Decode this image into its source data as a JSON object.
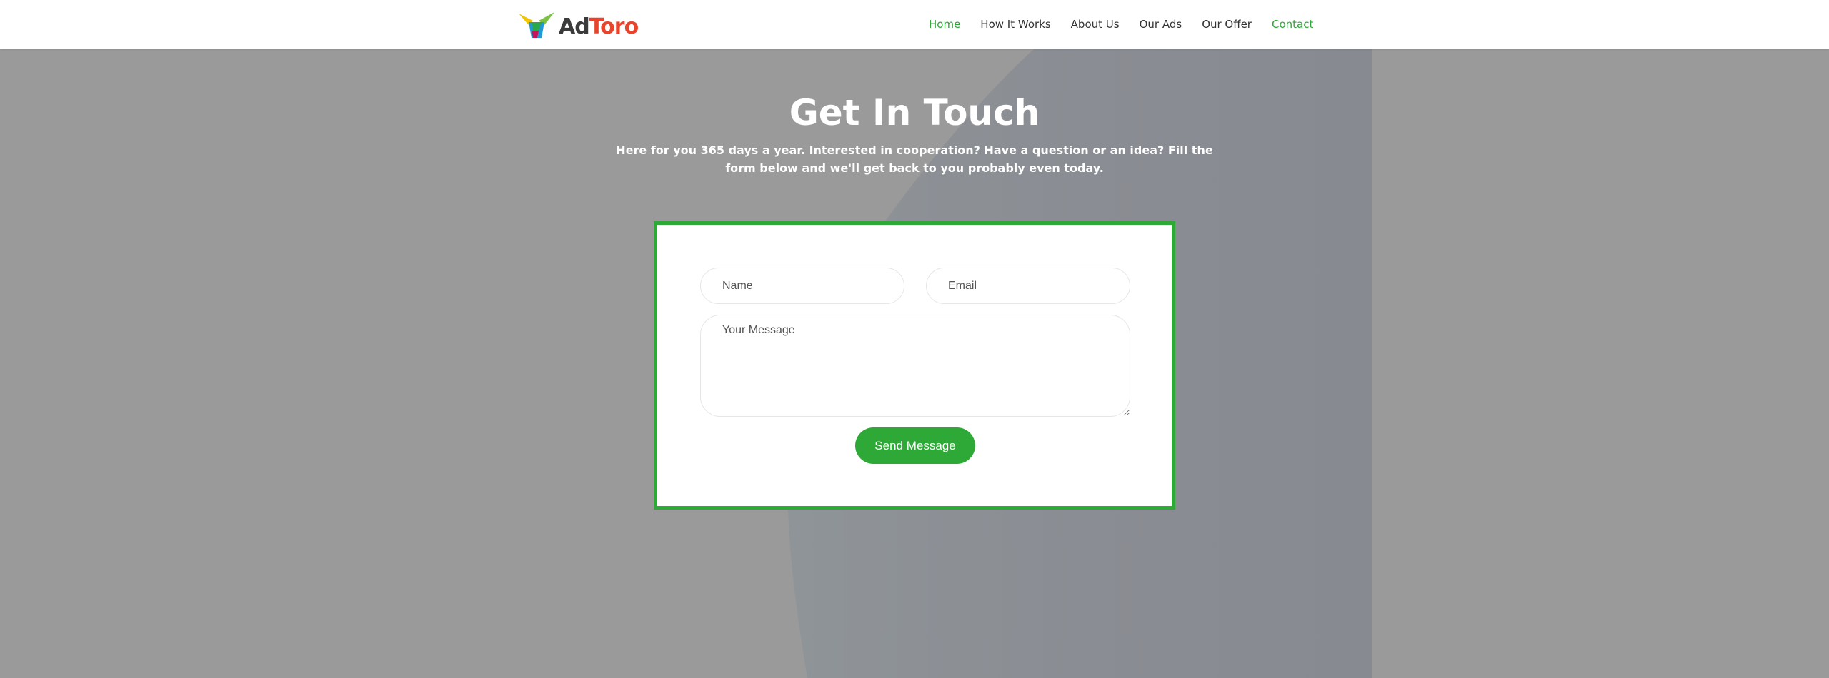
{
  "header": {
    "logo": {
      "text_part1": "Ad",
      "text_part2": "Toro"
    },
    "nav": [
      {
        "label": "Home",
        "active": true
      },
      {
        "label": "How It Works",
        "active": false
      },
      {
        "label": "About Us",
        "active": false
      },
      {
        "label": "Our Ads",
        "active": false
      },
      {
        "label": "Our Offer",
        "active": false
      },
      {
        "label": "Contact",
        "active": true
      }
    ]
  },
  "contact": {
    "title": "Get In Touch",
    "subtitle": "Here for you 365 days a year. Interested in cooperation? Have a question or an idea? Fill the form below and we'll get back to you probably even today.",
    "form": {
      "name_placeholder": "Name",
      "name_value": "",
      "email_placeholder": "Email",
      "email_value": "",
      "message_placeholder": "Your Message",
      "message_value": "",
      "submit_label": "Send Message"
    }
  },
  "colors": {
    "accent": "#2ea836",
    "logo_red": "#e8442c",
    "hero_gray": "#9a9a9a",
    "hero_overlay": "#8a8d93"
  }
}
